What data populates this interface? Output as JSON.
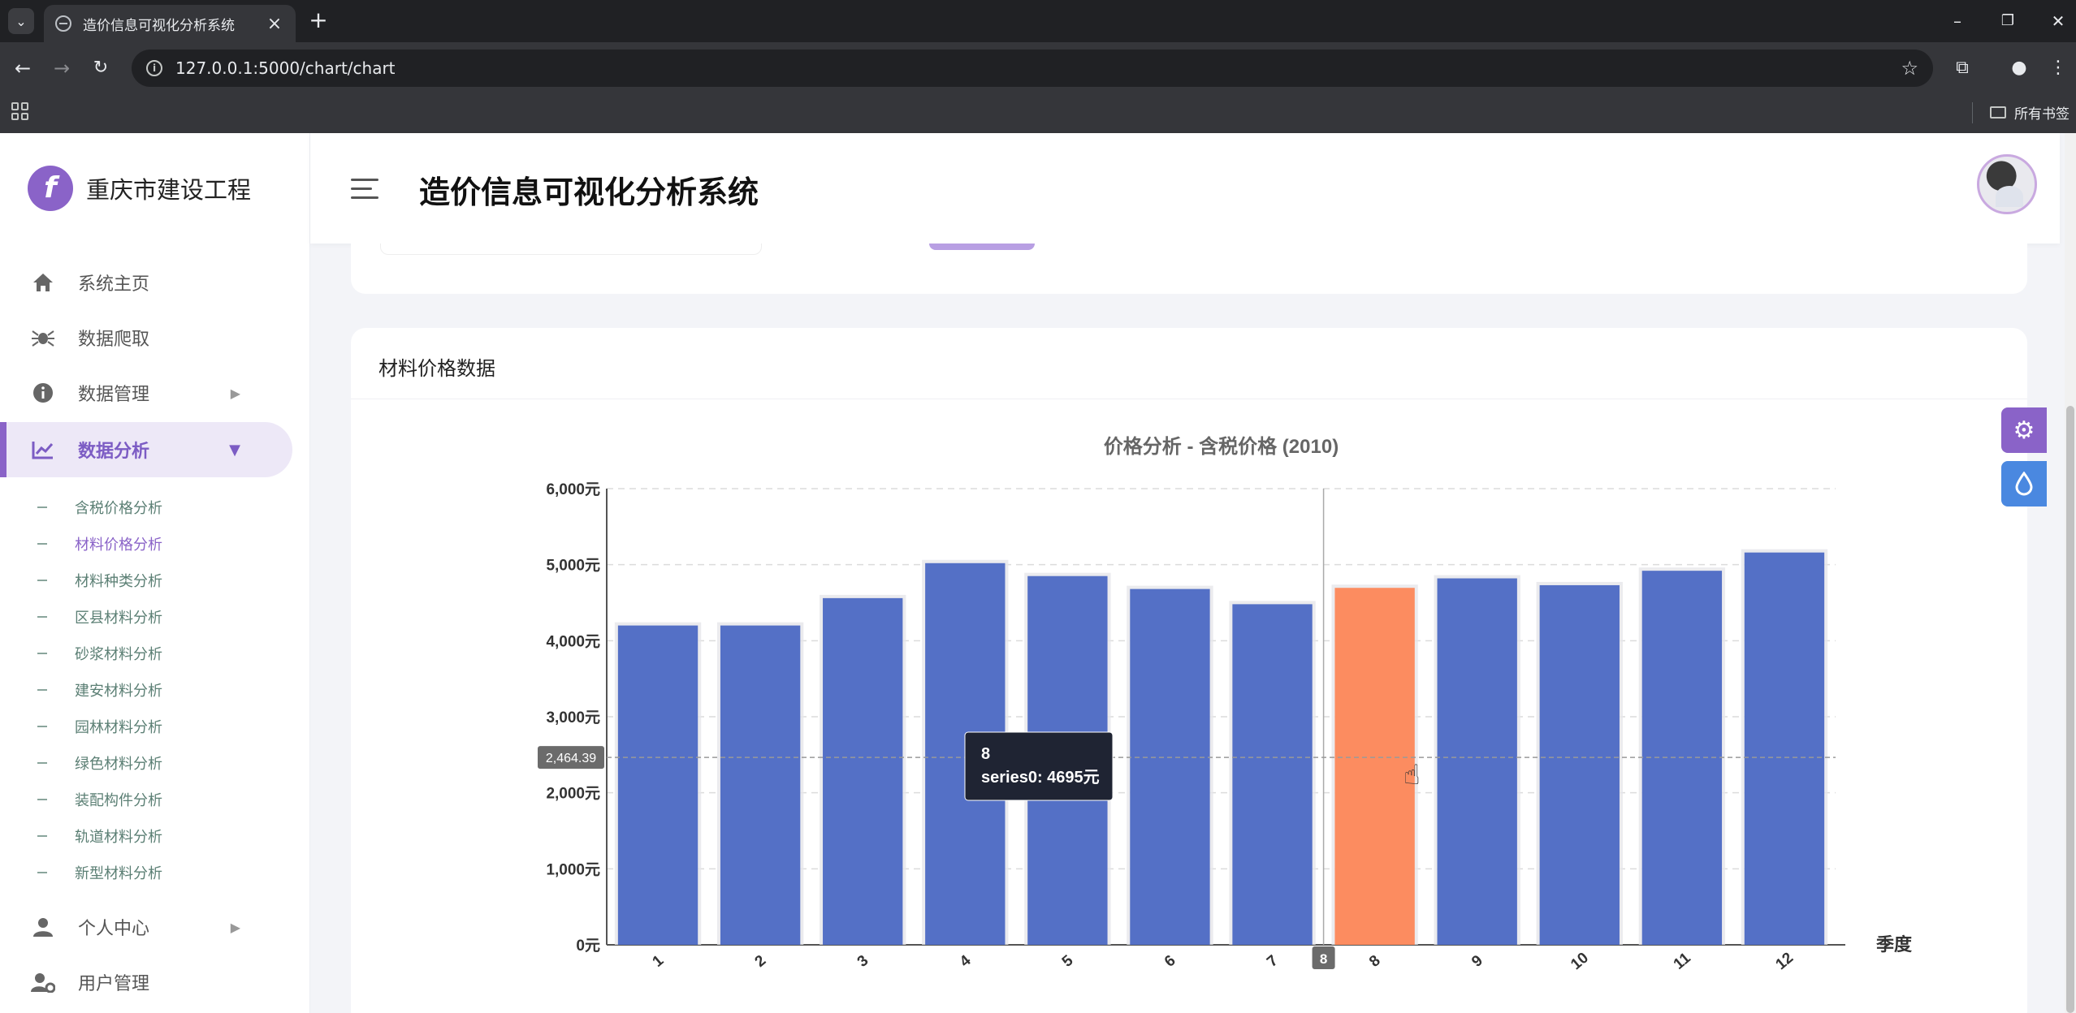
{
  "browser": {
    "tab_title": "造价信息可视化分析系统",
    "url": "127.0.0.1:5000/chart/chart",
    "bookmarks_label": "所有书签"
  },
  "sidebar": {
    "brand_name": "重庆市建设工程",
    "brand_letter": "f",
    "menu": [
      {
        "label": "系统主页",
        "icon": "home-icon"
      },
      {
        "label": "数据爬取",
        "icon": "spider-icon"
      },
      {
        "label": "数据管理",
        "icon": "info-circle-icon"
      },
      {
        "label": "数据分析",
        "icon": "chart-line-icon"
      },
      {
        "label": "个人中心",
        "icon": "user-icon"
      },
      {
        "label": "用户管理",
        "icon": "user-gear-icon"
      }
    ],
    "submenu": [
      "含税价格分析",
      "材料价格分析",
      "材料种类分析",
      "区县材料分析",
      "砂浆材料分析",
      "建安材料分析",
      "园林材料分析",
      "绿色材料分析",
      "装配构件分析",
      "轨道材料分析",
      "新型材料分析"
    ],
    "active_submenu_index": 1
  },
  "header": {
    "title": "造价信息可视化分析系统"
  },
  "card": {
    "title": "材料价格数据"
  },
  "colors": {
    "bar": "#5470c6",
    "bar_highlight": "#fc8c60",
    "accent": "#8a63c8"
  },
  "chart_data": {
    "type": "bar",
    "title": "价格分析 - 含税价格 (2010)",
    "xlabel": "季度",
    "ylabel": "",
    "categories": [
      "1",
      "2",
      "3",
      "4",
      "5",
      "6",
      "7",
      "8",
      "9",
      "10",
      "11",
      "12"
    ],
    "values": [
      4200,
      4200,
      4560,
      5020,
      4850,
      4680,
      4480,
      4695,
      4820,
      4730,
      4920,
      5160
    ],
    "ylim": [
      0,
      6000
    ],
    "yticks": [
      0,
      1000,
      2000,
      3000,
      4000,
      5000,
      6000
    ],
    "y_unit": "元",
    "y_tick_labels": [
      "0元",
      "1,000元",
      "2,000元",
      "3,000元",
      "4,000元",
      "5,000元",
      "6,000元"
    ],
    "grid": true,
    "highlight_index": 7,
    "crosshair_y_label": "2,464.39",
    "crosshair_y_value": 2464.39,
    "crosshair_x_label": "8",
    "tooltip": {
      "title": "8",
      "series_name": "series0",
      "text": "series0: 4695元"
    }
  }
}
